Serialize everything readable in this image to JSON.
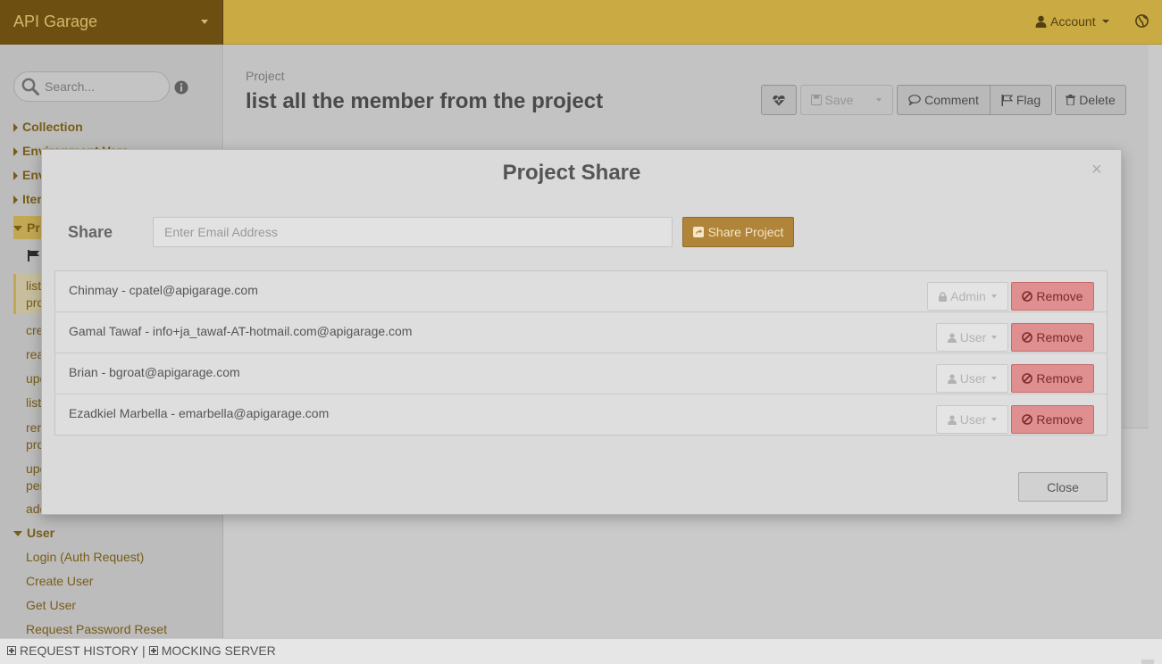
{
  "header": {
    "brand": "API Garage",
    "account_label": "Account"
  },
  "sidebar": {
    "search_placeholder": "Search...",
    "items": [
      {
        "label": "Collection"
      },
      {
        "label": "Environment Vars"
      },
      {
        "label": "Env"
      },
      {
        "label": "Item"
      },
      {
        "label": "Pr"
      },
      {
        "label": "list all the member from the project",
        "line1": "list",
        "line2": "pro"
      },
      {
        "label": "cre"
      },
      {
        "label": "rea"
      },
      {
        "label": "upd"
      },
      {
        "label": "list"
      },
      {
        "label": "rem",
        "line2": "pro"
      },
      {
        "label": "upd",
        "line2": "per"
      },
      {
        "label": "add"
      },
      {
        "label": "User"
      },
      {
        "label": "Login (Auth Request)"
      },
      {
        "label": "Create User"
      },
      {
        "label": "Get User"
      },
      {
        "label": "Request Password Reset"
      }
    ]
  },
  "main": {
    "breadcrumb": "Project",
    "title": "list all the member from the project",
    "toolbar": {
      "save_label": "Save",
      "comment_label": "Comment",
      "flag_label": "Flag",
      "delete_label": "Delete"
    }
  },
  "modal": {
    "title": "Project Share",
    "close_symbol": "×",
    "share_label": "Share",
    "email_placeholder": "Enter Email Address",
    "share_button": "Share Project",
    "members": [
      {
        "text": "Chinmay - cpatel@apigarage.com",
        "role": "Admin",
        "remove": "Remove"
      },
      {
        "text": "Gamal Tawaf - info+ja_tawaf-AT-hotmail.com@apigarage.com",
        "role": "User",
        "remove": "Remove"
      },
      {
        "text": "Brian - bgroat@apigarage.com",
        "role": "User",
        "remove": "Remove"
      },
      {
        "text": "Ezadkiel Marbella - emarbella@apigarage.com",
        "role": "User",
        "remove": "Remove"
      }
    ],
    "close_button": "Close"
  },
  "footer": {
    "request_history": "REQUEST HISTORY",
    "separator": "|",
    "mocking_server": "MOCKING SERVER"
  },
  "colors": {
    "topbar": "#e6c34d",
    "brand_bg": "#7d5c14",
    "share_button": "#b0853a",
    "remove_button": "#df8f8f",
    "link": "#8a6a1a"
  }
}
